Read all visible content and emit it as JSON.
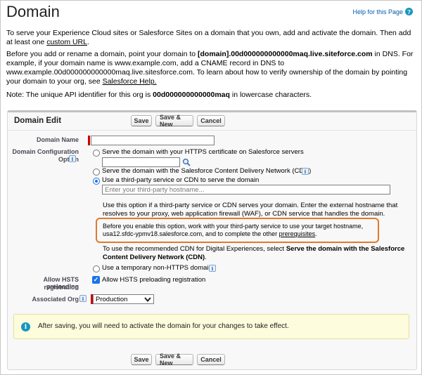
{
  "page": {
    "title": "Domain",
    "help_label": "Help for this Page",
    "intro_1_a": "To serve your Experience Cloud sites or Salesforce Sites on a domain that you own, add and activate the domain. Then add at least one ",
    "intro_1_link": "custom URL",
    "intro_1_b": ".",
    "intro_2_a": "Before you add or rename a domain, point your domain to ",
    "intro_2_bold": "[domain].00d000000000000maq.live.siteforce.com",
    "intro_2_b": " in DNS. For example, if your domain name is www.example.com, add a CNAME record in DNS to www.example.00d000000000000maq.live.sitesforce.com. To learn about how to verify ownership of the domain by pointing your domain to your org, see ",
    "intro_2_link": "Salesforce Help.",
    "note_a": "Note: The unique API identifier for this org is ",
    "note_bold": "00d000000000000maq",
    "note_b": " in lowercase characters."
  },
  "panel": {
    "title": "Domain Edit",
    "buttons": {
      "save": "Save",
      "save_new": "Save & New",
      "cancel": "Cancel"
    }
  },
  "form": {
    "domain_name_label": "Domain Name",
    "domain_name_value": "",
    "config_label_1": "Domain Configuration",
    "config_label_2": "Option",
    "option_https": "Serve the domain with your HTTPS certificate on Salesforce servers",
    "option_cdn": "Serve the domain with the Salesforce Content Delivery Network (CDN)",
    "option_third_party": "Use a third-party service or CDN to serve the domain",
    "third_party_placeholder": "Enter your third-party hostname...",
    "third_party_help": "Use this option if a third-party service or CDN serves your domain. Enter the external hostname that resolves to your proxy, web application firewall (WAF), or CDN service that handles the domain.",
    "highlight_a": "Before you enable this option, work with your third-party service to use your target hostname, usa12.sfdc-ypmv18.salesforce.com, and to complete the other ",
    "highlight_link": "prerequisites",
    "highlight_b": ".",
    "cdn_tip_a": "To use the recommended CDN for Digital Experiences, select ",
    "cdn_tip_bold": "Serve the domain with the Salesforce Content Delivery Network (CDN)",
    "cdn_tip_b": ".",
    "option_temporary": "Use a temporary non-HTTPS domain",
    "hsts_label_1": "Allow HSTS preloading",
    "hsts_label_2": "registration",
    "hsts_checkbox_label": "Allow HSTS preloading registration",
    "org_label": "Associated Org",
    "org_value": "Production",
    "selected_option": "third_party",
    "hsts_checked": true
  },
  "notice": {
    "text": "After saving, you will need to activate the domain for your changes to take effect."
  },
  "icons": {
    "help": "question-circle-icon",
    "info": "info-icon",
    "lookup": "magnifier-icon",
    "dropdown": "chevron-down-icon"
  },
  "colors": {
    "highlight_border": "#e07a2c",
    "radio_selected": "#1a73e8",
    "notice_background": "#fdfcdc",
    "required_bar": "#cc0000"
  }
}
